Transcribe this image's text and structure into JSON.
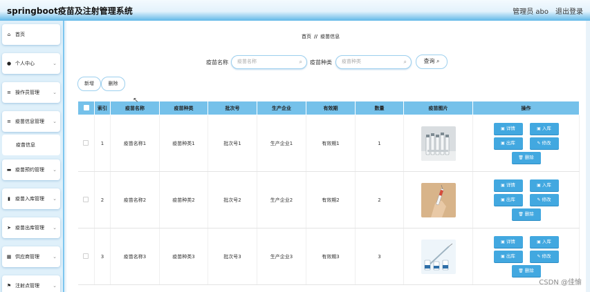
{
  "header": {
    "title": "springboot疫苗及注射管理系统",
    "user": "管理员 abo",
    "logout": "退出登录"
  },
  "sidebar": {
    "items": [
      {
        "label": "首页",
        "icon": "home-icon",
        "glyph": "⌂",
        "chevron": false
      },
      {
        "label": "个人中心",
        "icon": "person-icon",
        "glyph": "●",
        "chevron": true
      },
      {
        "label": "操作员管理",
        "icon": "list-icon",
        "glyph": "≡",
        "chevron": true
      },
      {
        "label": "疫苗信息管理",
        "icon": "list-icon",
        "glyph": "≡",
        "chevron": true
      },
      {
        "label": "疫苗信息",
        "sub": true
      },
      {
        "label": "疫苗预约管理",
        "icon": "briefcase-icon",
        "glyph": "▬",
        "chevron": true
      },
      {
        "label": "疫苗入库管理",
        "icon": "mobile-icon",
        "glyph": "▮",
        "chevron": true
      },
      {
        "label": "疫苗出库管理",
        "icon": "send-icon",
        "glyph": "➤",
        "chevron": true
      },
      {
        "label": "供应商管理",
        "icon": "grid-icon",
        "glyph": "▦",
        "chevron": true
      },
      {
        "label": "注射点管理",
        "icon": "flag-icon",
        "glyph": "⚑",
        "chevron": true
      }
    ]
  },
  "breadcrumb": {
    "home": "首页",
    "sep": "//",
    "current": "疫苗信息"
  },
  "search": {
    "name_label": "疫苗名称",
    "name_placeholder": "疫苗名称",
    "type_label": "疫苗种类",
    "type_placeholder": "疫苗种类",
    "query_label": "查询"
  },
  "actions": {
    "add": "新增",
    "delete": "删除"
  },
  "table": {
    "columns": [
      "索引",
      "疫苗名称",
      "疫苗种类",
      "批次号",
      "生产企业",
      "有效期",
      "数量",
      "疫苗图片",
      "操作"
    ],
    "rows": [
      {
        "index": "1",
        "name": "疫苗名称1",
        "type": "疫苗种类1",
        "batch": "批次号1",
        "maker": "生产企业1",
        "expiry": "有效期1",
        "qty": "1",
        "image": "vials-image"
      },
      {
        "index": "2",
        "name": "疫苗名称2",
        "type": "疫苗种类2",
        "batch": "批次号2",
        "maker": "生产企业2",
        "expiry": "有效期2",
        "qty": "2",
        "image": "syringe-hand-image"
      },
      {
        "index": "3",
        "name": "疫苗名称3",
        "type": "疫苗种类3",
        "batch": "批次号3",
        "maker": "生产企业3",
        "expiry": "有效期3",
        "qty": "3",
        "image": "syringe-bottles-image"
      }
    ],
    "ops": {
      "detail": "详情",
      "in": "入库",
      "out": "出库",
      "edit": "修改",
      "delete": "删除"
    }
  },
  "watermark": "CSDN @佳愉",
  "colors": {
    "accent": "#42a8e0",
    "header_bar": "#75c1ea",
    "sidebar_bg": "#dff0fa"
  }
}
